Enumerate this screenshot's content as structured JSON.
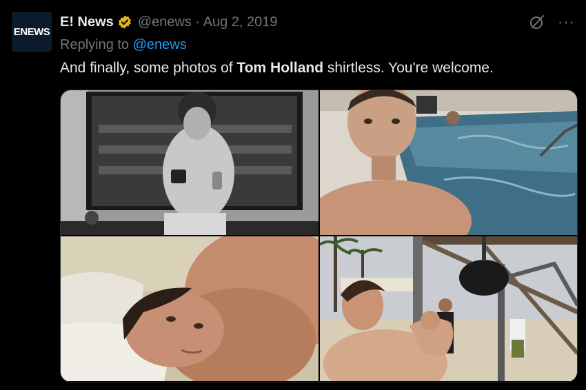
{
  "tweet": {
    "author_name": "E! News",
    "handle": "@enews",
    "separator": "·",
    "date": "Aug 2, 2019",
    "avatar_text": "ENEWS",
    "replying_prefix": "Replying to",
    "replying_handle": "@enews",
    "text_before": "And finally, some photos of ",
    "text_bold": "Tom Holland",
    "text_after": " shirtless. You're welcome.",
    "more_label": "···"
  },
  "icons": {
    "verified": "verified-badge-icon",
    "grok": "grok-icon",
    "more": "more-icon"
  },
  "colors": {
    "background": "#000000",
    "text": "#e7e9ea",
    "muted": "#71767b",
    "link": "#1d9bf0",
    "verified_gold": "#e2b719"
  }
}
